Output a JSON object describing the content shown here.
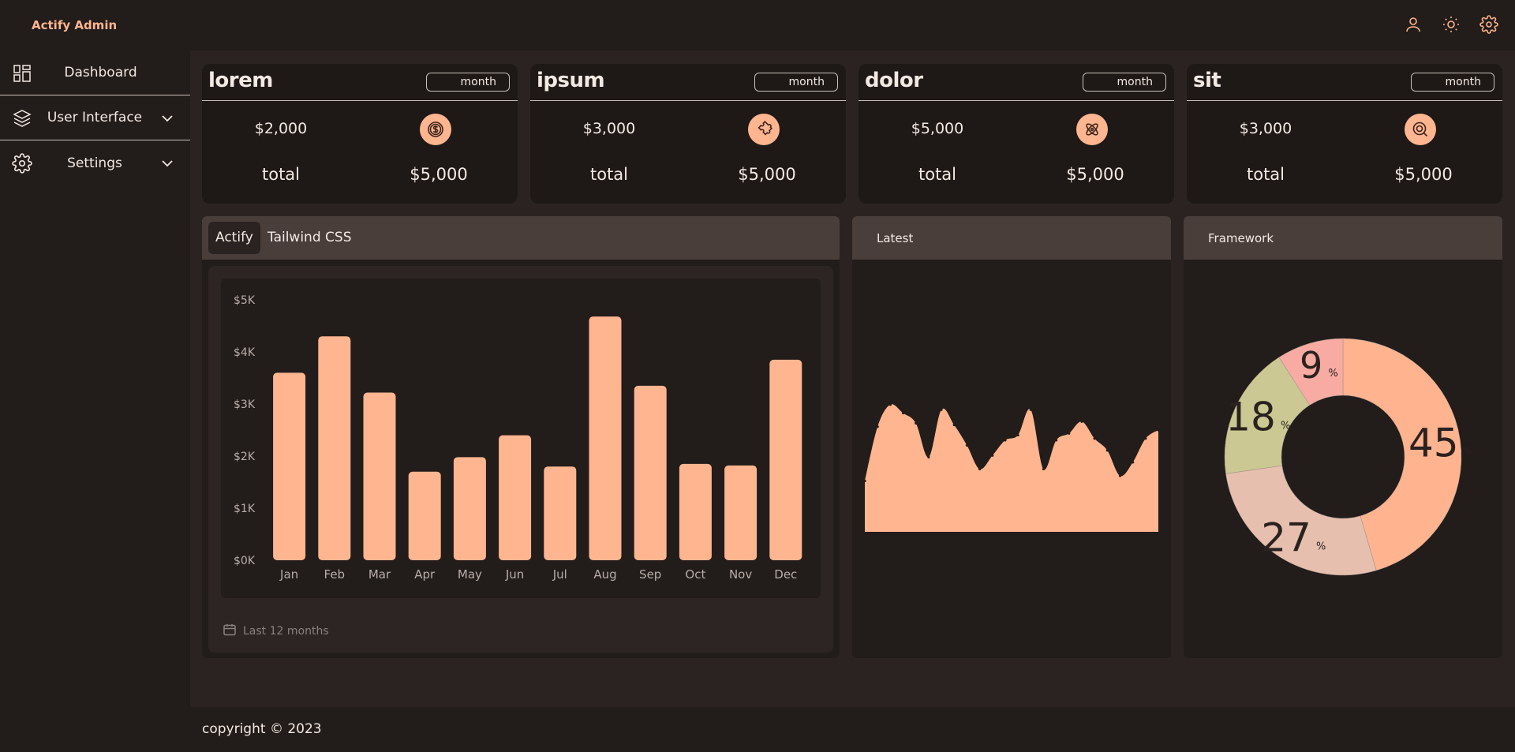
{
  "header": {
    "brand": "Actify Admin",
    "icons": [
      "user-icon",
      "sun-icon",
      "gear-icon"
    ]
  },
  "sidebar": {
    "items": [
      {
        "label": "Dashboard",
        "icon": "dashboard-icon"
      },
      {
        "label": "User Interface",
        "icon": "layers-icon"
      },
      {
        "label": "Settings",
        "icon": "gear-icon"
      }
    ]
  },
  "cards": [
    {
      "title": "lorem",
      "period": "month",
      "amount": "$2,000",
      "icon": "dollar-icon",
      "total_label": "total",
      "total_value": "$5,000"
    },
    {
      "title": "ipsum",
      "period": "month",
      "amount": "$3,000",
      "icon": "puzzle-icon",
      "total_label": "total",
      "total_value": "$5,000"
    },
    {
      "title": "dolor",
      "period": "month",
      "amount": "$5,000",
      "icon": "atom-icon",
      "total_label": "total",
      "total_value": "$5,000"
    },
    {
      "title": "sit",
      "period": "month",
      "amount": "$3,000",
      "icon": "target-icon",
      "total_label": "total",
      "total_value": "$5,000"
    }
  ],
  "tabs": [
    {
      "label": "Actify",
      "active": true
    },
    {
      "label": "Tailwind CSS",
      "active": false
    }
  ],
  "bar_footer": "Last 12 months",
  "latest_title": "Latest",
  "framework_title": "Framework",
  "footer": "copyright © 2023",
  "colors": {
    "accent": "#ffb58f",
    "bg": "#221c1a",
    "main_bg": "#2a2321",
    "panel_head": "#4a3e3a",
    "donut_45": "#ffb38f",
    "donut_27": "#e6bfae",
    "donut_18": "#cbc893",
    "donut_9": "#f7aba2"
  },
  "chart_data": [
    {
      "type": "bar",
      "categories": [
        "Jan",
        "Feb",
        "Mar",
        "Apr",
        "May",
        "Jun",
        "Jul",
        "Aug",
        "Sep",
        "Oct",
        "Nov",
        "Dec"
      ],
      "values": [
        3600,
        4300,
        3220,
        1700,
        1980,
        2400,
        1800,
        4680,
        3350,
        1850,
        1820,
        3850
      ],
      "ytick_labels": [
        "$0K",
        "$1K",
        "$2K",
        "$3K",
        "$4K",
        "$5K"
      ],
      "ylim": [
        0,
        5000
      ],
      "grid": false
    },
    {
      "type": "area",
      "y": [
        30,
        62,
        75,
        70,
        64,
        44,
        72,
        63,
        51,
        37,
        45,
        54,
        57,
        72,
        37,
        54,
        58,
        65,
        55,
        48,
        33,
        41,
        55,
        60
      ],
      "ylim": [
        0,
        100
      ],
      "axes": false
    },
    {
      "type": "pie",
      "donut": true,
      "values": [
        45,
        27,
        18,
        9
      ],
      "labels": [
        "45",
        "27",
        "18",
        "9"
      ],
      "unit": "%"
    }
  ]
}
